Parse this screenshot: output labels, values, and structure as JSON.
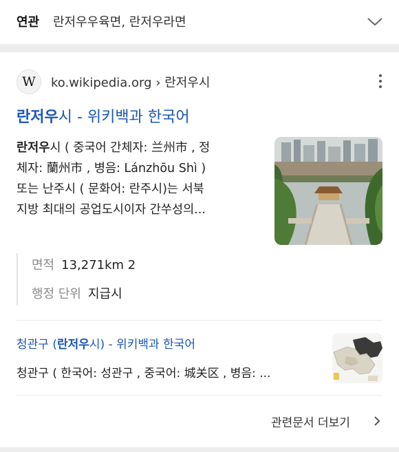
{
  "related": {
    "label": "연관",
    "text": "란저우우육면, 란저우라면",
    "expand_icon": "chevron-down-icon"
  },
  "result": {
    "site_logo_letter": "W",
    "source": "ko.wikipedia.org › 란저우시",
    "title_highlight": "란저우",
    "title_rest": "시 - 위키백과 한국어",
    "snippet_highlight": "란저우",
    "snippet_lines": [
      "시 ( 중국어 간체자: 兰州市 , 정",
      "체자: 蘭州市 , 병음: Lánzhōu Shì )",
      "또는 난주시 ( 문화어: 란주시)는 서북",
      "지방 최대의 공업도시이자 간쑤성의..."
    ],
    "facts": [
      {
        "key": "면적",
        "value": "13,271km 2"
      },
      {
        "key": "행정 단위",
        "value": "지급시"
      }
    ]
  },
  "sub_result": {
    "title_pre": "청관구 (",
    "title_highlight": "란저우",
    "title_rest": "시) - 위키백과 한국어",
    "snippet": "청관구 ( 한국어: 성관구 , 중국어: 城关区 , 병음: ..."
  },
  "more_label": "관련문서 더보기",
  "colors": {
    "link": "#1a56b6",
    "background": "#ededed",
    "card": "#ffffff"
  }
}
